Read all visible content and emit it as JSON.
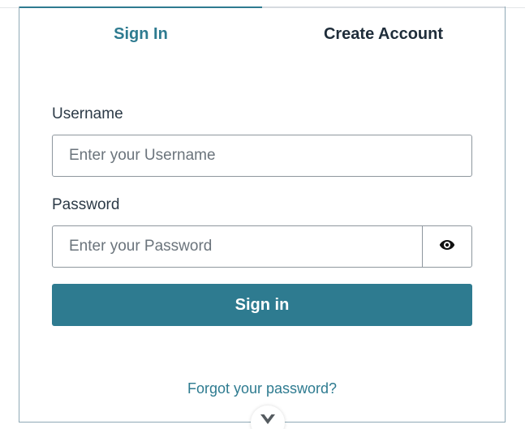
{
  "tabs": {
    "sign_in": "Sign In",
    "create_account": "Create Account"
  },
  "form": {
    "username_label": "Username",
    "username_placeholder": "Enter your Username",
    "username_value": "",
    "password_label": "Password",
    "password_placeholder": "Enter your Password",
    "password_value": "",
    "show_password_icon": "eye-icon",
    "submit_label": "Sign in"
  },
  "forgot_password_label": "Forgot your password?",
  "scroll_indicator_icon": "chevron-down-icon",
  "colors": {
    "accent": "#2e7b90",
    "text": "#1f2d3a",
    "input_border": "#8e979e"
  }
}
